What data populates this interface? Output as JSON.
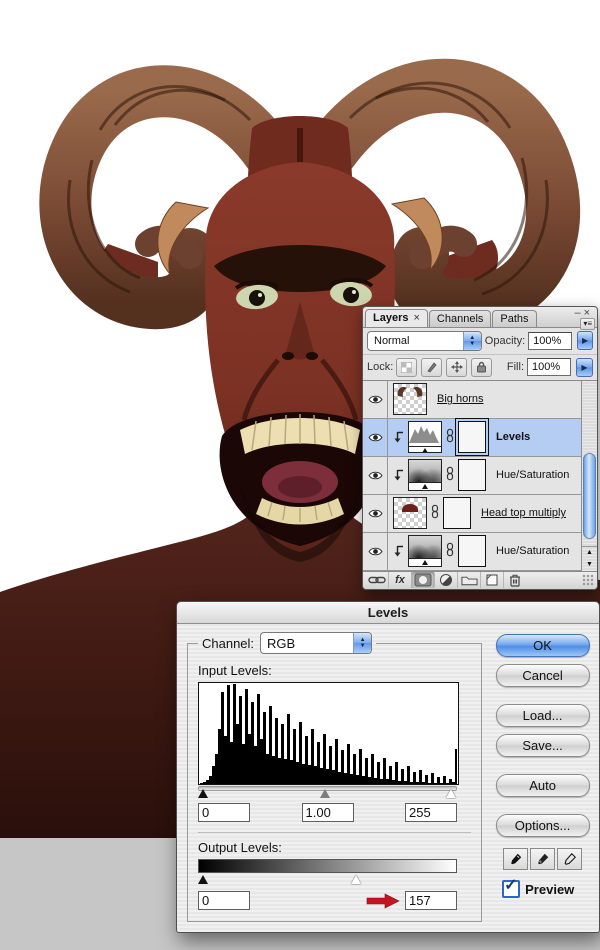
{
  "photo": {
    "description": "Photo-manipulation of a screaming red-skinned demon head with large curled ram horns on a white canvas; gray application background strip at the bottom"
  },
  "colors": {
    "selection_blue": "#b5cdf2",
    "aqua_primary_button": "#4f8ee8",
    "annotation_arrow_red": "#c41622",
    "canvas_background_gray": "#c6c6c6"
  },
  "layers_panel": {
    "tabs": [
      {
        "label": "Layers",
        "close_icon": "×"
      },
      {
        "label": "Channels"
      },
      {
        "label": "Paths"
      }
    ],
    "window": {
      "minimize": "–",
      "close": "×"
    },
    "blend_mode_value": "Normal",
    "opacity_label": "Opacity:",
    "opacity_value": "100%",
    "lock_label": "Lock:",
    "fill_label": "Fill:",
    "fill_value": "100%",
    "layers": [
      {
        "name": "Big horns"
      },
      {
        "name": "Levels"
      },
      {
        "name": "Hue/Saturation"
      },
      {
        "name": "Head top multiply"
      },
      {
        "name": "Hue/Saturation"
      }
    ]
  },
  "levels_dialog": {
    "title": "Levels",
    "channel_label": "Channel:",
    "channel_value": "RGB",
    "input_label": "Input Levels:",
    "input_black": "0",
    "input_gamma": "1.00",
    "input_white": "255",
    "output_label": "Output Levels:",
    "output_black": "0",
    "output_white": "157",
    "buttons": [
      "OK",
      "Cancel",
      "Load...",
      "Save...",
      "Auto",
      "Options..."
    ],
    "preview_label": "Preview",
    "histogram": [
      1,
      2,
      4,
      8,
      18,
      30,
      55,
      92,
      48,
      99,
      42,
      100,
      60,
      88,
      40,
      95,
      50,
      82,
      38,
      90,
      45,
      72,
      30,
      78,
      28,
      66,
      26,
      60,
      25,
      70,
      24,
      55,
      22,
      62,
      20,
      48,
      19,
      55,
      18,
      42,
      16,
      50,
      15,
      38,
      14,
      45,
      12,
      34,
      11,
      40,
      10,
      30,
      9,
      35,
      8,
      26,
      7,
      30,
      6,
      22,
      5,
      26,
      5,
      18,
      4,
      22,
      3,
      15,
      3,
      18,
      2,
      12,
      2,
      14,
      2,
      9,
      1,
      11,
      1,
      7,
      1,
      8,
      1,
      5,
      2,
      35
    ]
  }
}
